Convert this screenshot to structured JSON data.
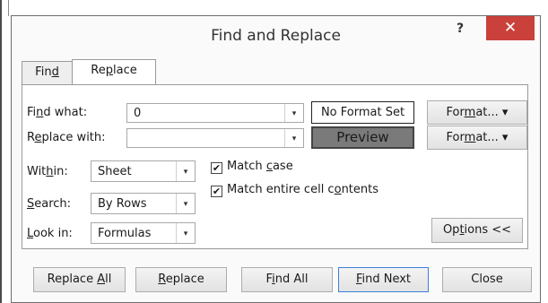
{
  "dialog": {
    "title": "Find and Replace",
    "help_label": "?",
    "close_label": "✕"
  },
  "tabs": [
    {
      "pre": "Fin",
      "key": "d",
      "post": ""
    },
    {
      "pre": "Re",
      "key": "p",
      "post": "lace"
    }
  ],
  "find": {
    "label_pre": "Fi",
    "label_key": "n",
    "label_post": "d what:",
    "value": "0",
    "format_status": "No Format Set",
    "format_pre": "For",
    "format_key": "m",
    "format_post": "at...",
    "format_arrow": "▾"
  },
  "replace": {
    "label_pre": "R",
    "label_key": "e",
    "label_post": "place with:",
    "value": "",
    "preview_label": "Preview",
    "format_pre": "For",
    "format_key": "m",
    "format_post": "at...",
    "format_arrow": "▾"
  },
  "options": {
    "within": {
      "label_pre": "Wit",
      "label_key": "h",
      "label_post": "in:",
      "value": "Sheet"
    },
    "search": {
      "label_pre": "",
      "label_key": "S",
      "label_post": "earch:",
      "value": "By Rows"
    },
    "look_in": {
      "label_pre": "",
      "label_key": "L",
      "label_post": "ook in:",
      "value": "Formulas"
    },
    "match_case": {
      "pre": "Match ",
      "key": "c",
      "post": "ase",
      "checked": "✔"
    },
    "match_entire": {
      "pre": "Match entire cell c",
      "key": "o",
      "post": "ntents",
      "checked": "✔"
    },
    "options_button": {
      "pre": "Op",
      "key": "t",
      "post": "ions <<"
    }
  },
  "buttons": {
    "replace_all": {
      "pre": "Replace ",
      "key": "A",
      "post": "ll"
    },
    "replace": {
      "pre": "",
      "key": "R",
      "post": "eplace"
    },
    "find_all": {
      "pre": "F",
      "key": "i",
      "post": "nd All"
    },
    "find_next": {
      "pre": "",
      "key": "F",
      "post": "ind Next"
    },
    "close": {
      "pre": "Close",
      "key": "",
      "post": ""
    }
  },
  "icons": {
    "dropdown": "▾"
  },
  "colors": {
    "close_button": "#c9413a",
    "preview_bg": "#7a7a7a",
    "default_button_border": "#3c7fd8"
  }
}
